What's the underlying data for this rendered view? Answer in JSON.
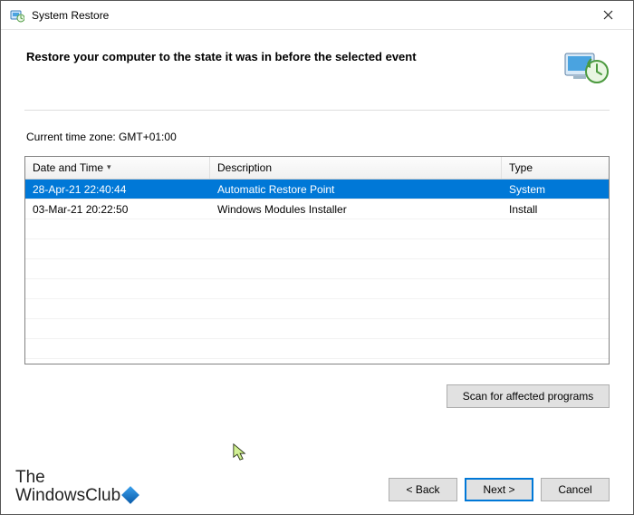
{
  "window": {
    "title": "System Restore",
    "heading": "Restore your computer to the state it was in before the selected event"
  },
  "timezone_label": "Current time zone: GMT+01:00",
  "columns": {
    "datetime": "Date and Time",
    "description": "Description",
    "type": "Type"
  },
  "rows": [
    {
      "datetime": "28-Apr-21 22:40:44",
      "description": "Automatic Restore Point",
      "type": "System",
      "selected": true
    },
    {
      "datetime": "03-Mar-21 20:22:50",
      "description": "Windows Modules Installer",
      "type": "Install",
      "selected": false
    }
  ],
  "buttons": {
    "scan": "Scan for affected programs",
    "back": "< Back",
    "next": "Next >",
    "cancel": "Cancel"
  },
  "watermark": {
    "line1": "The",
    "line2": "WindowsClub"
  }
}
